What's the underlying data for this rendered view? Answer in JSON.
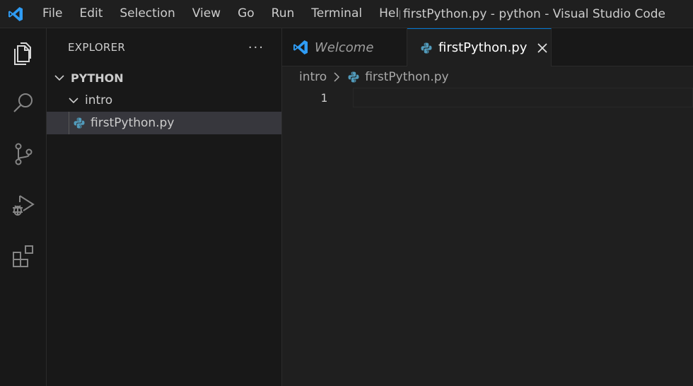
{
  "menu": [
    "File",
    "Edit",
    "Selection",
    "View",
    "Go",
    "Run",
    "Terminal",
    "Help"
  ],
  "window_title": "firstPython.py - python - Visual Studio Code",
  "activity_bar": [
    "files-icon",
    "search-icon",
    "source-control-icon",
    "run-debug-icon",
    "extensions-icon"
  ],
  "sidebar": {
    "title": "EXPLORER",
    "more": "···",
    "root": "PYTHON",
    "folder": "intro",
    "file": "firstPython.py"
  },
  "tabs": {
    "welcome": "Welcome",
    "active": "firstPython.py"
  },
  "breadcrumb": {
    "folder": "intro",
    "file": "firstPython.py"
  },
  "editor": {
    "line_number": "1"
  },
  "colors": {
    "accent": "#0078d4",
    "vscode_blue": "#2f9cf4",
    "python_blue": "#519aba"
  }
}
